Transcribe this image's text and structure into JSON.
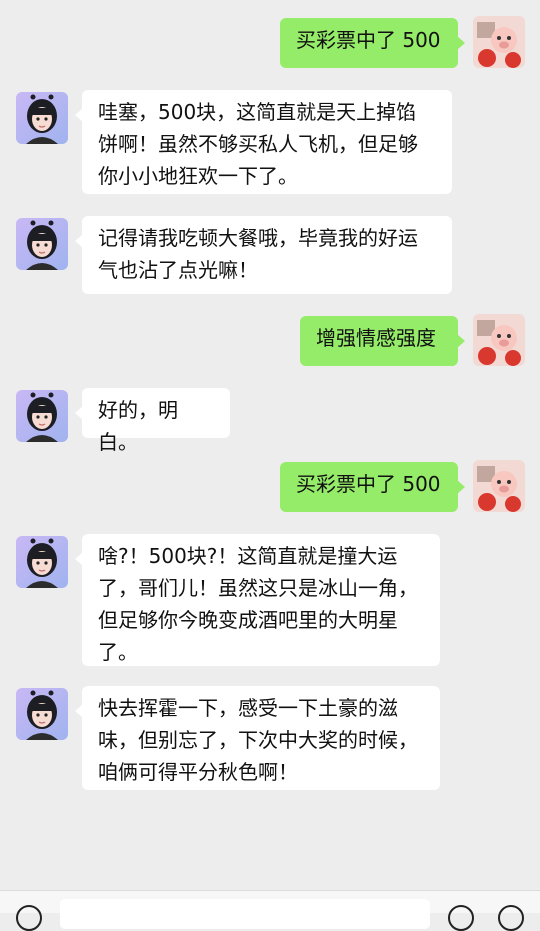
{
  "messages": [
    {
      "side": "right",
      "text": "买彩票中了 500"
    },
    {
      "side": "left",
      "text": "哇塞，500块，这简直就是天上掉馅饼啊！虽然不够买私人飞机，但足够你小小地狂欢一下了。"
    },
    {
      "side": "left",
      "text": "记得请我吃顿大餐哦，毕竟我的好运气也沾了点光嘛！"
    },
    {
      "side": "right",
      "text": "增强情感强度"
    },
    {
      "side": "left",
      "text": "好的，明白。"
    },
    {
      "side": "right",
      "text": "买彩票中了 500"
    },
    {
      "side": "left",
      "text": "啥?！500块?！这简直就是撞大运了，哥们儿！虽然这只是冰山一角，但足够你今晚变成酒吧里的大明星了。"
    },
    {
      "side": "left",
      "text": "快去挥霍一下，感受一下土豪的滋味，但别忘了，下次中大奖的时候，咱俩可得平分秋色啊！"
    }
  ],
  "colors": {
    "background": "#ededed",
    "bubble_self": "#95ec69",
    "bubble_other": "#ffffff"
  },
  "icons": {
    "bot_avatar": "girl-avatar-icon",
    "user_avatar": "pig-avatar-icon",
    "voice": "voice-icon",
    "emoji": "emoji-icon",
    "plus": "plus-icon"
  }
}
